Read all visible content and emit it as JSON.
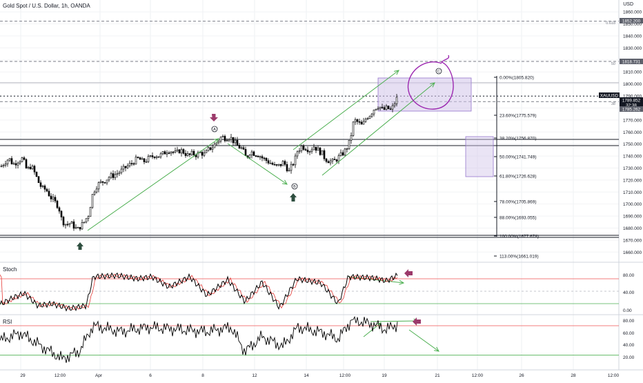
{
  "header": {
    "title": "Gold Spot / U.S. Dollar, 1h, OANDA",
    "currency": "USD",
    "stoch_label": "Stoch",
    "rsi_label": "RSI"
  },
  "price_axis": {
    "ticks": [
      "1860.000",
      "1850.000",
      "1840.000",
      "1830.000",
      "1820.000",
      "1810.000",
      "1800.000",
      "1790.000",
      "1780.000",
      "1770.000",
      "1760.000",
      "1750.000",
      "1740.000",
      "1730.000",
      "1720.000",
      "1710.000",
      "1700.000",
      "1690.000",
      "1680.000",
      "1670.000",
      "1660.000"
    ],
    "labels": [
      {
        "text": "1852.200",
        "bg": "#5d606b"
      },
      {
        "text": "1818.731",
        "bg": "#5d606b"
      },
      {
        "text": "XAUUSD",
        "bg": "#131722"
      },
      {
        "text": "1789.852",
        "bg": "#131722"
      },
      {
        "text": "32:38",
        "bg": "#131722"
      },
      {
        "text": "1785.262",
        "bg": "#5d606b"
      }
    ]
  },
  "fib_levels": [
    {
      "text": "0.00%(1805.820)"
    },
    {
      "text": "23.60%(1775.579)"
    },
    {
      "text": "38.20%(1756.870)"
    },
    {
      "text": "50.00%(1741.749)"
    },
    {
      "text": "61.80%(1726.628)"
    },
    {
      "text": "78.00%(1705.869)"
    },
    {
      "text": "88.00%(1693.055)"
    },
    {
      "text": "100.00%(1677.678)"
    },
    {
      "text": "113.00%(1661.019)"
    }
  ],
  "fib_small_labels": [
    "0.618",
    "50",
    "38"
  ],
  "wave_labels": [
    "A",
    "B",
    "C"
  ],
  "stoch_axis": [
    "80.00",
    "40.00",
    "0.00"
  ],
  "rsi_axis": [
    "80.00",
    "60.00",
    "40.00",
    "20.00"
  ],
  "time_axis": [
    "29",
    "12:00",
    "Apr",
    "6",
    "8",
    "12",
    "14",
    "12:00",
    "19",
    "21",
    "12:00",
    "26",
    "28",
    "12:00"
  ],
  "colors": {
    "up": "#ffffff",
    "down": "#000000",
    "arrow_green": "#4caf50",
    "arrow_purple": "#9c3a6b",
    "zone": "#d1c4e9",
    "marker_up": "#2e4e3f",
    "circle": "#9c27b0",
    "stoch_line": "#e53935",
    "level_red": "#ef5350",
    "level_green": "#4caf50"
  },
  "chart_data": {
    "type": "candlestick",
    "instrument": "Gold Spot / U.S. Dollar",
    "interval": "1h",
    "ylim": [
      1655,
      1863
    ],
    "close_path": [
      [
        0,
        1731
      ],
      [
        6,
        1735
      ],
      [
        12,
        1738
      ],
      [
        18,
        1733
      ],
      [
        25,
        1736
      ],
      [
        32,
        1738
      ],
      [
        38,
        1728
      ],
      [
        44,
        1732
      ],
      [
        50,
        1725
      ],
      [
        55,
        1718
      ],
      [
        60,
        1713
      ],
      [
        66,
        1712
      ],
      [
        72,
        1706
      ],
      [
        78,
        1702
      ],
      [
        84,
        1698
      ],
      [
        88,
        1688
      ],
      [
        92,
        1684
      ],
      [
        96,
        1683
      ],
      [
        100,
        1684
      ],
      [
        104,
        1683
      ],
      [
        108,
        1680
      ],
      [
        112,
        1679
      ],
      [
        116,
        1682
      ],
      [
        120,
        1684
      ],
      [
        124,
        1688
      ],
      [
        128,
        1692
      ],
      [
        132,
        1706
      ],
      [
        136,
        1712
      ],
      [
        140,
        1716
      ],
      [
        146,
        1718
      ],
      [
        152,
        1720
      ],
      [
        158,
        1723
      ],
      [
        164,
        1724
      ],
      [
        170,
        1726
      ],
      [
        176,
        1728
      ],
      [
        182,
        1731
      ],
      [
        188,
        1733
      ],
      [
        194,
        1736
      ],
      [
        200,
        1738
      ],
      [
        206,
        1735
      ],
      [
        212,
        1737
      ],
      [
        218,
        1739
      ],
      [
        224,
        1741
      ],
      [
        230,
        1740
      ],
      [
        236,
        1742
      ],
      [
        242,
        1745
      ],
      [
        248,
        1744
      ],
      [
        254,
        1742
      ],
      [
        260,
        1745
      ],
      [
        266,
        1743
      ],
      [
        272,
        1740
      ],
      [
        278,
        1742
      ],
      [
        284,
        1741
      ],
      [
        290,
        1743
      ],
      [
        296,
        1741
      ],
      [
        302,
        1746
      ],
      [
        308,
        1748
      ],
      [
        314,
        1752
      ],
      [
        320,
        1756
      ],
      [
        326,
        1755
      ],
      [
        332,
        1756
      ],
      [
        338,
        1752
      ],
      [
        344,
        1748
      ],
      [
        350,
        1746
      ],
      [
        356,
        1738
      ],
      [
        362,
        1744
      ],
      [
        368,
        1742
      ],
      [
        374,
        1741
      ],
      [
        380,
        1738
      ],
      [
        386,
        1736
      ],
      [
        392,
        1734
      ],
      [
        398,
        1731
      ],
      [
        404,
        1732
      ],
      [
        410,
        1735
      ],
      [
        414,
        1731
      ],
      [
        418,
        1727
      ],
      [
        422,
        1732
      ],
      [
        426,
        1736
      ],
      [
        430,
        1744
      ],
      [
        436,
        1748
      ],
      [
        442,
        1747
      ],
      [
        448,
        1745
      ],
      [
        454,
        1748
      ],
      [
        460,
        1745
      ],
      [
        466,
        1742
      ],
      [
        470,
        1738
      ],
      [
        476,
        1736
      ],
      [
        482,
        1735
      ],
      [
        488,
        1738
      ],
      [
        494,
        1741
      ],
      [
        500,
        1745
      ],
      [
        506,
        1752
      ],
      [
        512,
        1770
      ],
      [
        518,
        1768
      ],
      [
        524,
        1765
      ],
      [
        530,
        1772
      ],
      [
        536,
        1775
      ],
      [
        542,
        1780
      ],
      [
        548,
        1782
      ],
      [
        554,
        1778
      ],
      [
        560,
        1780
      ],
      [
        566,
        1778
      ],
      [
        570,
        1783
      ],
      [
        576,
        1790
      ]
    ],
    "horizontal_levels": [
      1852.2,
      1818.731,
      1789.852,
      1785.262,
      1757.5,
      1754,
      1752,
      1678.5,
      1677
    ],
    "stoch": {
      "levels": [
        80,
        20
      ],
      "ylim": [
        0,
        100
      ]
    },
    "rsi": {
      "levels": [
        70,
        30
      ],
      "ylim": [
        10,
        85
      ]
    }
  }
}
